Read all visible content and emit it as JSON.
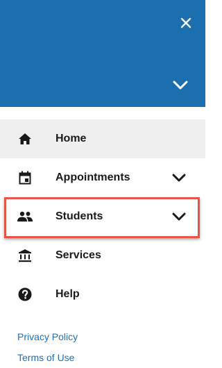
{
  "header": {
    "close_icon": "close-icon",
    "expand_icon": "chevron-down-icon",
    "background_color": "#1b6fae"
  },
  "nav": {
    "items": [
      {
        "label": "Home",
        "icon": "home-icon",
        "active": true,
        "expandable": false
      },
      {
        "label": "Appointments",
        "icon": "calendar-icon",
        "active": false,
        "expandable": true
      },
      {
        "label": "Students",
        "icon": "people-icon",
        "active": false,
        "expandable": true,
        "highlighted": true
      },
      {
        "label": "Services",
        "icon": "bank-icon",
        "active": false,
        "expandable": false
      },
      {
        "label": "Help",
        "icon": "help-icon",
        "active": false,
        "expandable": false
      }
    ]
  },
  "footer": {
    "privacy_label": "Privacy Policy",
    "terms_label": "Terms of Use",
    "link_color": "#1f6fb3"
  },
  "highlight_color": "#e5554a"
}
